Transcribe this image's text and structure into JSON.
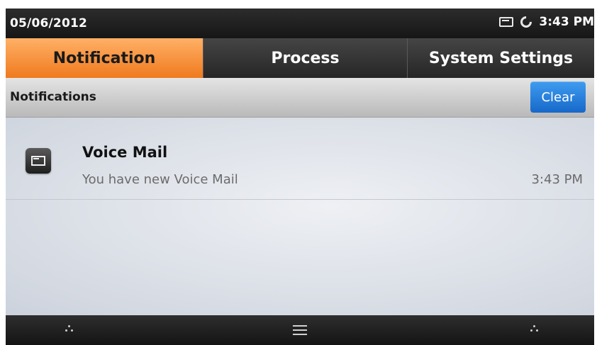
{
  "status_bar": {
    "date": "05/06/2012",
    "time": "3:43 PM",
    "icons": [
      "voicemail-icon",
      "sync-icon"
    ]
  },
  "tabs": [
    {
      "label": "Notification",
      "active": true
    },
    {
      "label": "Process",
      "active": false
    },
    {
      "label": "System Settings",
      "active": false
    }
  ],
  "section": {
    "title": "Notifications",
    "clear_label": "Clear"
  },
  "notifications": [
    {
      "icon": "voicemail-icon",
      "title": "Voice Mail",
      "subtitle": "You have new Voice Mail",
      "time": "3:43 PM"
    }
  ],
  "nav_icons": [
    "dots-left-icon",
    "menu-icon",
    "dots-right-icon"
  ],
  "colors": {
    "active_tab": "#f08a2c",
    "clear_button": "#2a82e0"
  }
}
